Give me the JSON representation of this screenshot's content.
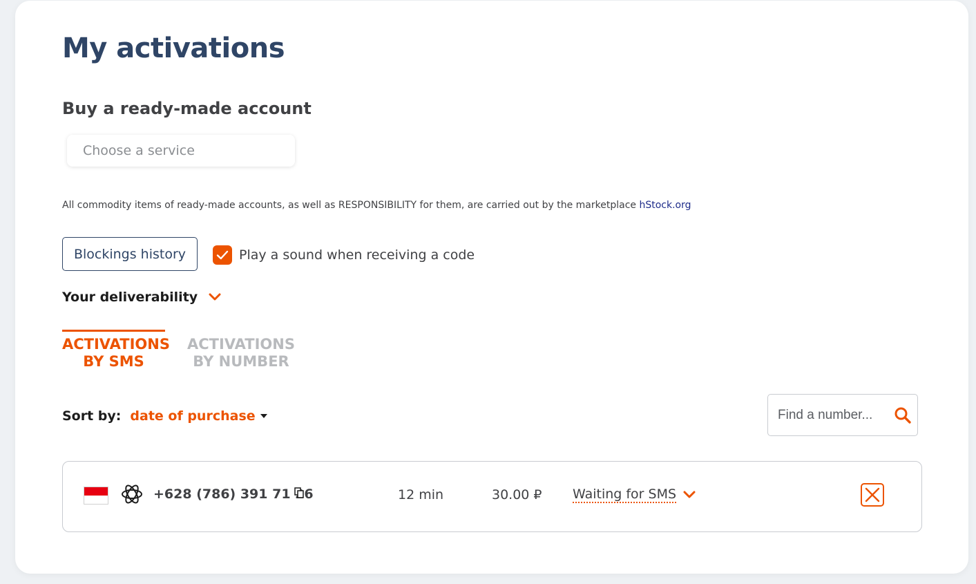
{
  "page": {
    "title": "My activations"
  },
  "buy_section": {
    "heading": "Buy a ready-made account",
    "service_placeholder": "Choose a service",
    "disclaimer_text": "All commodity items of ready-made accounts, as well as RESPONSIBILITY for them, are carried out by the marketplace ",
    "marketplace_link": "hStock.org"
  },
  "controls": {
    "blockings_history_label": "Blockings history",
    "sound_label": "Play a sound when receiving a code",
    "sound_checked": true,
    "deliverability_label": "Your deliverability"
  },
  "tabs": [
    {
      "line1": "ACTIVATIONS",
      "line2": "BY SMS",
      "active": true
    },
    {
      "line1": "ACTIVATIONS",
      "line2": "BY NUMBER",
      "active": false
    }
  ],
  "sort": {
    "label": "Sort by:",
    "value": "date of purchase"
  },
  "search": {
    "placeholder": "Find a number..."
  },
  "activations": [
    {
      "country_flag": "indonesia-flag",
      "service_icon": "openai-icon",
      "phone": "+628 (786) 391 71 26",
      "duration": "12 min",
      "price": "30.00 ₽",
      "status": "Waiting for SMS"
    }
  ],
  "colors": {
    "accent": "#ec5300",
    "title": "#2f4566",
    "text": "#404144",
    "inactive_tab": "#b8babd",
    "link": "#1e2c8a"
  }
}
